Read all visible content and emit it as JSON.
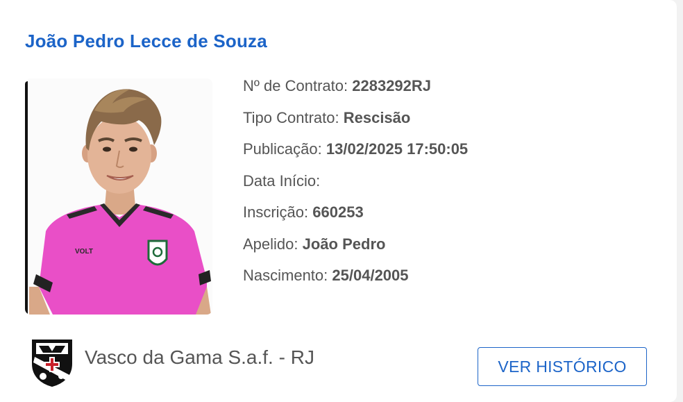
{
  "player": {
    "name": "João Pedro Lecce de Souza"
  },
  "details": [
    {
      "label": "Nº de Contrato:",
      "value": "2283292RJ"
    },
    {
      "label": "Tipo Contrato:",
      "value": "Rescisão"
    },
    {
      "label": "Publicação:",
      "value": "13/02/2025 17:50:05"
    },
    {
      "label": "Data Início:",
      "value": ""
    },
    {
      "label": "Inscrição:",
      "value": "660253"
    },
    {
      "label": "Apelido:",
      "value": "João Pedro"
    },
    {
      "label": "Nascimento:",
      "value": "25/04/2005"
    }
  ],
  "club": {
    "name": "Vasco da Gama S.a.f. - RJ",
    "crest_icon": "vasco-crest-icon"
  },
  "actions": {
    "history_label": "VER HISTÓRICO"
  },
  "colors": {
    "accent": "#1c64c8",
    "text": "#555555",
    "jersey": "#e94fc7"
  }
}
